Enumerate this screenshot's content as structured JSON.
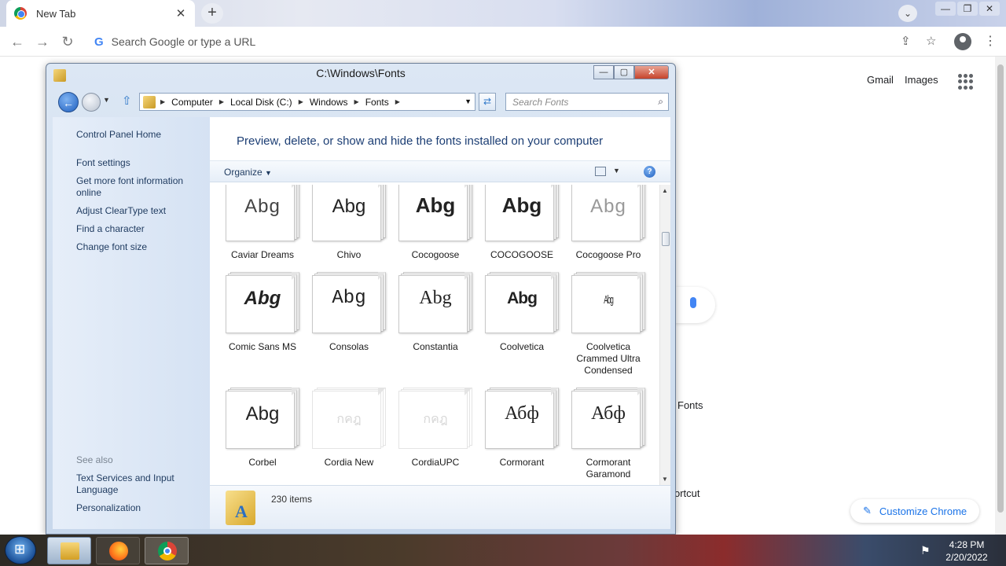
{
  "chrome": {
    "tab_title": "New Tab",
    "omnibox_placeholder": "Search Google or type a URL",
    "links": {
      "gmail": "Gmail",
      "images": "Images"
    },
    "shortcuts": [
      "Fonts",
      "ortcut"
    ],
    "customize_label": "Customize Chrome"
  },
  "explorer": {
    "title": "C:\\Windows\\Fonts",
    "breadcrumb": [
      "Computer",
      "Local Disk (C:)",
      "Windows",
      "Fonts"
    ],
    "search_placeholder": "Search Fonts",
    "nav_links": [
      "Control Panel Home",
      "Font settings",
      "Get more font information online",
      "Adjust ClearType text",
      "Find a character",
      "Change font size"
    ],
    "see_also_title": "See also",
    "see_also_links": [
      "Text Services and Input Language",
      "Personalization"
    ],
    "header": "Preview, delete, or show and hide the fonts installed on your computer",
    "organize_label": "Organize",
    "help_label": "?",
    "fonts": [
      {
        "name": "Caviar Dreams",
        "sample": "Abg"
      },
      {
        "name": "Chivo",
        "sample": "Abg"
      },
      {
        "name": "Cocogoose",
        "sample": "Abg"
      },
      {
        "name": "COCOGOOSE",
        "sample": "Abg"
      },
      {
        "name": "Cocogoose Pro",
        "sample": "Abg"
      },
      {
        "name": "Comic Sans MS",
        "sample": "Abg"
      },
      {
        "name": "Consolas",
        "sample": "Abg"
      },
      {
        "name": "Constantia",
        "sample": "Abg"
      },
      {
        "name": "Coolvetica",
        "sample": "Abg"
      },
      {
        "name": "Coolvetica Crammed Ultra Condensed",
        "sample": "Abg"
      },
      {
        "name": "Corbel",
        "sample": "Abg"
      },
      {
        "name": "Cordia New",
        "sample": "กคฎ"
      },
      {
        "name": "CordiaUPC",
        "sample": "กคฎ"
      },
      {
        "name": "Cormorant",
        "sample": "Абф"
      },
      {
        "name": "Cormorant Garamond",
        "sample": "Абф"
      }
    ],
    "item_count": "230 items"
  },
  "taskbar": {
    "time": "4:28 PM",
    "date": "2/20/2022"
  }
}
